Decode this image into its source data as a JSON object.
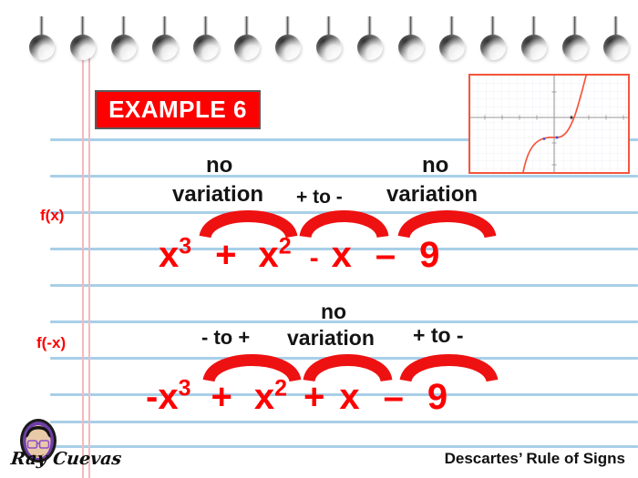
{
  "slide": {
    "badge_label": "EXAMPLE 6",
    "footer_title": "Descartes’ Rule of Signs",
    "signature": "Ray Cuevas"
  },
  "colors": {
    "accent_red": "#fe0000",
    "rule_line_blue": "#a8cfe8",
    "margin_pink": "#f5b9bd",
    "graph_border": "#f4563c",
    "curve": "#f4563c",
    "text_black": "#141414"
  },
  "rows": [
    {
      "label": "f(x)",
      "equation_terms": [
        "x",
        "3",
        "+",
        "x",
        "2",
        "-",
        "x",
        "–",
        "9"
      ],
      "equation_text": "x³ + x² - x – 9",
      "annotations": [
        {
          "id": "no-variation-1",
          "line1": "no",
          "line2": "variation"
        },
        {
          "id": "plus-to-minus-1",
          "text": "+ to -"
        },
        {
          "id": "no-variation-2",
          "line1": "no",
          "line2": "variation"
        }
      ]
    },
    {
      "label": "f(-x)",
      "equation_terms": [
        "-x",
        "3",
        "+",
        "x",
        "2",
        "+",
        "x",
        "–",
        "9"
      ],
      "equation_text": "-x³ + x² + x – 9",
      "annotations": [
        {
          "id": "minus-to-plus",
          "text": "- to +"
        },
        {
          "id": "no-variation-3",
          "line1": "no",
          "line2": "variation"
        },
        {
          "id": "plus-to-minus-2",
          "text": "+ to -"
        }
      ]
    }
  ],
  "annotation_text": {
    "no": "no",
    "variation": "variation",
    "plus_to_minus": "+ to -",
    "minus_to_plus": "- to +"
  },
  "graph": {
    "curve_description": "cubic-curve",
    "x_axis": "x-axis",
    "y_axis": "y-axis"
  },
  "notebook": {
    "hole_count": 15,
    "rule_line_tops": [
      152,
      192,
      232,
      272,
      312,
      352,
      392,
      432,
      472,
      512
    ]
  }
}
